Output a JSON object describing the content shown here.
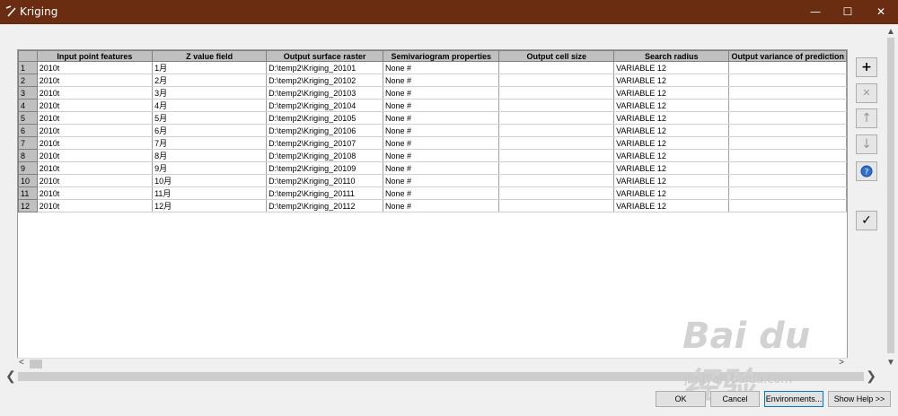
{
  "window": {
    "title": "Kriging",
    "minimize": "—",
    "maximize": "☐",
    "close": "✕"
  },
  "grid": {
    "columns": [
      "Input point features",
      "Z value field",
      "Output surface raster",
      "Semivariogram properties",
      "Output cell size",
      "Search radius",
      "Output variance of prediction"
    ],
    "rows": [
      {
        "num": "1",
        "input": "2010t",
        "z": "1月",
        "output": "D:\\temp2\\Kriging_20101",
        "semi": "None #",
        "cell": "",
        "radius": "VARIABLE 12",
        "variance": ""
      },
      {
        "num": "2",
        "input": "2010t",
        "z": "2月",
        "output": "D:\\temp2\\Kriging_20102",
        "semi": "None #",
        "cell": "",
        "radius": "VARIABLE 12",
        "variance": ""
      },
      {
        "num": "3",
        "input": "2010t",
        "z": "3月",
        "output": "D:\\temp2\\Kriging_20103",
        "semi": "None #",
        "cell": "",
        "radius": "VARIABLE 12",
        "variance": ""
      },
      {
        "num": "4",
        "input": "2010t",
        "z": "4月",
        "output": "D:\\temp2\\Kriging_20104",
        "semi": "None #",
        "cell": "",
        "radius": "VARIABLE 12",
        "variance": ""
      },
      {
        "num": "5",
        "input": "2010t",
        "z": "5月",
        "output": "D:\\temp2\\Kriging_20105",
        "semi": "None #",
        "cell": "",
        "radius": "VARIABLE 12",
        "variance": ""
      },
      {
        "num": "6",
        "input": "2010t",
        "z": "6月",
        "output": "D:\\temp2\\Kriging_20106",
        "semi": "None #",
        "cell": "",
        "radius": "VARIABLE 12",
        "variance": ""
      },
      {
        "num": "7",
        "input": "2010t",
        "z": "7月",
        "output": "D:\\temp2\\Kriging_20107",
        "semi": "None #",
        "cell": "",
        "radius": "VARIABLE 12",
        "variance": ""
      },
      {
        "num": "8",
        "input": "2010t",
        "z": "8月",
        "output": "D:\\temp2\\Kriging_20108",
        "semi": "None #",
        "cell": "",
        "radius": "VARIABLE 12",
        "variance": ""
      },
      {
        "num": "9",
        "input": "2010t",
        "z": "9月",
        "output": "D:\\temp2\\Kriging_20109",
        "semi": "None #",
        "cell": "",
        "radius": "VARIABLE 12",
        "variance": ""
      },
      {
        "num": "10",
        "input": "2010t",
        "z": "10月",
        "output": "D:\\temp2\\Kriging_20110",
        "semi": "None #",
        "cell": "",
        "radius": "VARIABLE 12",
        "variance": ""
      },
      {
        "num": "11",
        "input": "2010t",
        "z": "11月",
        "output": "D:\\temp2\\Kriging_20111",
        "semi": "None #",
        "cell": "",
        "radius": "VARIABLE 12",
        "variance": ""
      },
      {
        "num": "12",
        "input": "2010t",
        "z": "12月",
        "output": "D:\\temp2\\Kriging_20112",
        "semi": "None #",
        "cell": "",
        "radius": "VARIABLE 12",
        "variance": ""
      }
    ]
  },
  "side_buttons": {
    "add": "+",
    "remove": "✕",
    "up": "↑",
    "down": "↓",
    "help": "?",
    "check": "✓"
  },
  "bottom_buttons": {
    "ok": "OK",
    "cancel": "Cancel",
    "environments": "Environments...",
    "show_help": "Show Help >>"
  },
  "scroll": {
    "left": "<",
    "right": ">",
    "big_left": "❮",
    "big_right": "❯",
    "up": "▲",
    "down": "▼"
  },
  "watermark": {
    "brand": "Bai du 经验",
    "url": "jingyan.baidu.com"
  },
  "colors": {
    "titlebar": "#6b2d12",
    "accent": "#0078d7"
  }
}
